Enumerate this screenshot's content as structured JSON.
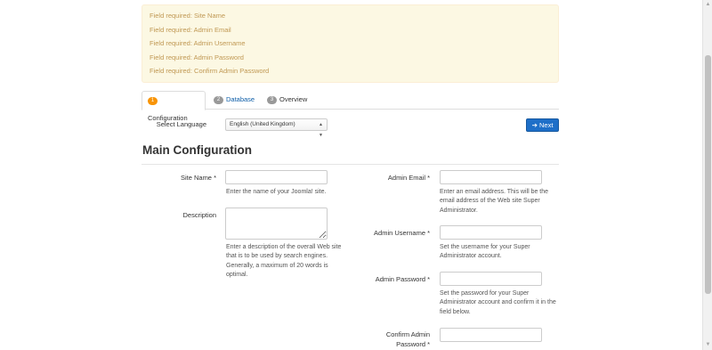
{
  "alert": {
    "messages": [
      "Field required: Site Name",
      "Field required: Admin Email",
      "Field required: Admin Username",
      "Field required: Admin Password",
      "Field required: Confirm Admin Password"
    ]
  },
  "tabs": [
    {
      "number": "1",
      "label": "Configuration"
    },
    {
      "number": "2",
      "label": "Database"
    },
    {
      "number": "3",
      "label": "Overview"
    }
  ],
  "language": {
    "label": "Select Language",
    "selected": "English (United Kingdom)"
  },
  "next_button": {
    "label": "Next",
    "icon": "arrow-right-icon"
  },
  "section": {
    "title": "Main Configuration"
  },
  "form": {
    "site_name": {
      "label": "Site Name *",
      "help": "Enter the name of your Joomla! site.",
      "value": ""
    },
    "description": {
      "label": "Description",
      "help": "Enter a description of the overall Web site that is to be used by search engines. Generally, a maximum of 20 words is optimal.",
      "value": ""
    },
    "admin_email": {
      "label": "Admin Email *",
      "help": "Enter an email address. This will be the email address of the Web site Super Administrator.",
      "value": ""
    },
    "admin_username": {
      "label": "Admin Username *",
      "help": "Set the username for your Super Administrator account.",
      "value": ""
    },
    "admin_password": {
      "label": "Admin Password *",
      "help": "Set the password for your Super Administrator account and confirm it in the field below.",
      "value": ""
    },
    "confirm_password": {
      "label": "Confirm Admin Password *",
      "value": ""
    }
  },
  "colors": {
    "alert_bg": "#fcf8e3",
    "alert_text": "#c09853",
    "primary": "#1e6fc8",
    "badge_active": "#f89406",
    "badge_inactive": "#999999",
    "link": "#0e5ea8"
  }
}
